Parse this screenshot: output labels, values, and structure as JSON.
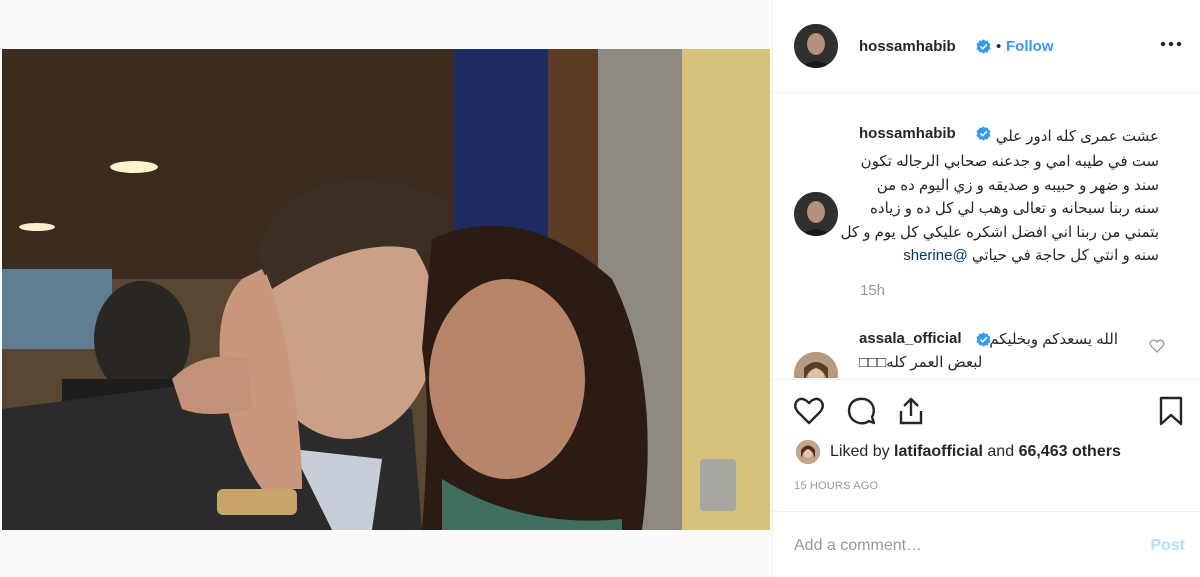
{
  "post": {
    "username": "hossamhabib",
    "follow_label": "Follow",
    "dot": "•",
    "verified_icon": "verified-badge-icon",
    "accent": "#3897f0"
  },
  "caption": {
    "username": "hossamhabib",
    "line1": "عشت عمرى كله ادور علي",
    "lines": [
      "ست في طيبه امي و جدعنه صحابي الرجاله تكون",
      "سند و ضهر و حبيبه و صديقه و زي اليوم ده من",
      "سنه ربنا سبحانه و تعالى وهب لي كل ده و زياده",
      "بتمني من ربنا اني افضل اشكره عليكي كل يوم و كل"
    ],
    "last_line_text": "سنه و انتي كل حاجة في حياتي",
    "mention": "@sherine",
    "time": "15h"
  },
  "comment2": {
    "username": "assala_official",
    "line1": "الله يسعدكم وبخليكم",
    "line2": "لبعض العمر كله□□□"
  },
  "actions": {
    "like_icon": "heart-icon",
    "comment_icon": "comment-icon",
    "share_icon": "share-icon",
    "save_icon": "bookmark-icon"
  },
  "likes": {
    "prefix": "Liked by",
    "user": "latifaofficial",
    "middle": "and",
    "count": "66,463 others"
  },
  "timeago": "15 HOURS AGO",
  "comment_box": {
    "placeholder": "Add a comment…",
    "post_label": "Post"
  }
}
